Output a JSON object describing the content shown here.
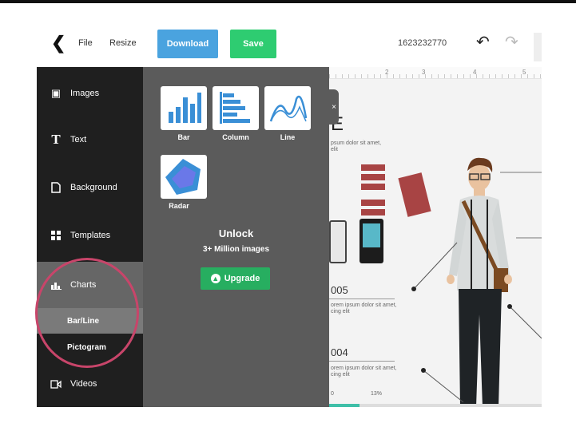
{
  "topbar": {
    "back_icon": "chevron-left-icon",
    "file_label": "File",
    "resize_label": "Resize",
    "download_label": "Download",
    "save_label": "Save",
    "document_id": "1623232770",
    "undo_icon": "undo-icon",
    "redo_icon": "redo-icon"
  },
  "colors": {
    "download": "#4aa3df",
    "save": "#2ecc71",
    "upgrade": "#27ae60",
    "highlight": "#c8456a",
    "sidebar_bg": "#1f1f1f",
    "panel_bg": "#5b5b5b"
  },
  "sidebar": {
    "items": [
      {
        "label": "Images",
        "icon": "image-icon"
      },
      {
        "label": "Text",
        "icon": "text-icon"
      },
      {
        "label": "Background",
        "icon": "page-icon"
      },
      {
        "label": "Templates",
        "icon": "templates-icon"
      },
      {
        "label": "Charts",
        "icon": "chart-icon"
      },
      {
        "label": "Videos",
        "icon": "video-icon"
      }
    ],
    "sub_items": [
      {
        "label": "Bar/Line"
      },
      {
        "label": "Pictogram"
      }
    ]
  },
  "panel": {
    "close_label": "×",
    "charts": [
      {
        "label": "Bar",
        "icon": "bar-chart-icon"
      },
      {
        "label": "Column",
        "icon": "column-chart-icon"
      },
      {
        "label": "Line",
        "icon": "line-chart-icon"
      },
      {
        "label": "Radar",
        "icon": "radar-chart-icon"
      }
    ],
    "unlock_title": "Unlock",
    "unlock_subtitle": "3+ Million images",
    "upgrade_label": "Upgrade"
  },
  "canvas": {
    "ruler_numbers": [
      "2",
      "3",
      "4",
      "5"
    ],
    "title_fragment": "E",
    "text_block_1": "psum dolor sit amet,\nelit",
    "number_1": "005",
    "text_block_2": "orem ipsum dolor sit amet,\ncing elit",
    "number_2": "004",
    "text_block_3": "orem ipsum dolor sit amet,\ncing elit",
    "axis_left": "0",
    "percent": "13%"
  }
}
